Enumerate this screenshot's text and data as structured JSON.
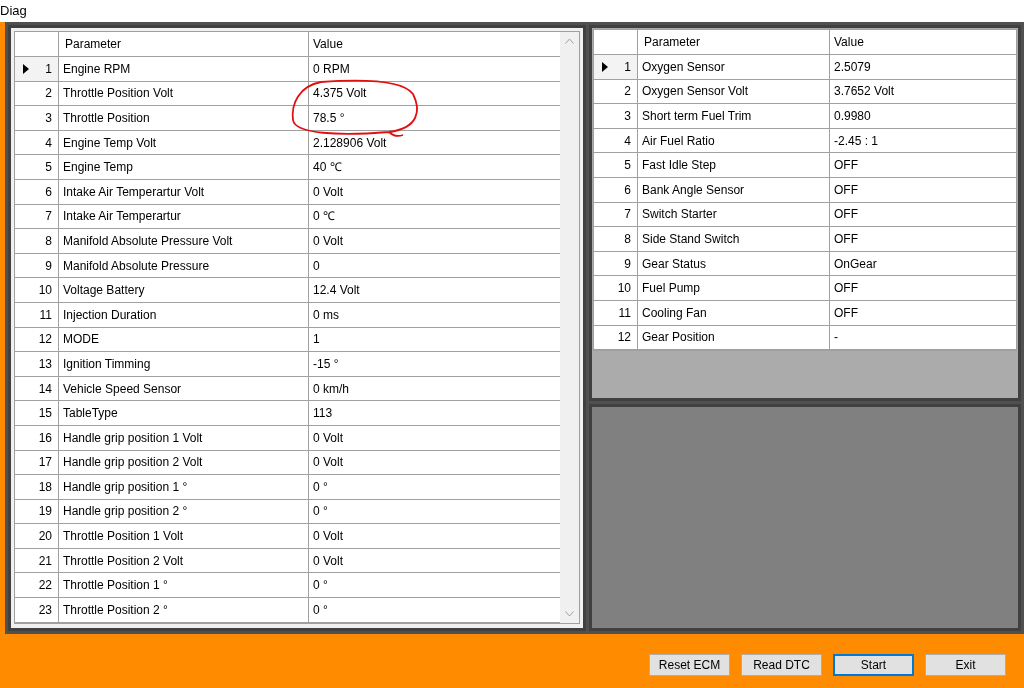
{
  "window": {
    "title": "Diag"
  },
  "left_table": {
    "columns": [
      "Parameter",
      "Value"
    ],
    "rows": [
      {
        "number": "1",
        "parameter": "Engine RPM",
        "value": "0 RPM",
        "selected": true
      },
      {
        "number": "2",
        "parameter": "Throttle Position Volt",
        "value": "4.375 Volt",
        "selected": false
      },
      {
        "number": "3",
        "parameter": "Throttle Position",
        "value": "78.5 °",
        "selected": false
      },
      {
        "number": "4",
        "parameter": "Engine Temp Volt",
        "value": "2.128906 Volt",
        "selected": false
      },
      {
        "number": "5",
        "parameter": "Engine Temp",
        "value": "40 ℃",
        "selected": false
      },
      {
        "number": "6",
        "parameter": "Intake Air Temperartur Volt",
        "value": "0 Volt",
        "selected": false
      },
      {
        "number": "7",
        "parameter": "Intake Air Temperartur",
        "value": "0 ℃",
        "selected": false
      },
      {
        "number": "8",
        "parameter": "Manifold Absolute Pressure Volt",
        "value": "0 Volt",
        "selected": false
      },
      {
        "number": "9",
        "parameter": "Manifold Absolute Pressure",
        "value": "0",
        "selected": false
      },
      {
        "number": "10",
        "parameter": "Voltage Battery",
        "value": "12.4 Volt",
        "selected": false
      },
      {
        "number": "11",
        "parameter": "Injection Duration",
        "value": "0 ms",
        "selected": false
      },
      {
        "number": "12",
        "parameter": "MODE",
        "value": "1",
        "selected": false
      },
      {
        "number": "13",
        "parameter": "Ignition Timming",
        "value": "-15 °",
        "selected": false
      },
      {
        "number": "14",
        "parameter": "Vehicle Speed Sensor",
        "value": "0 km/h",
        "selected": false
      },
      {
        "number": "15",
        "parameter": "TableType",
        "value": "113",
        "selected": false
      },
      {
        "number": "16",
        "parameter": "Handle grip position 1 Volt",
        "value": "0 Volt",
        "selected": false
      },
      {
        "number": "17",
        "parameter": "Handle grip position 2 Volt",
        "value": "0 Volt",
        "selected": false
      },
      {
        "number": "18",
        "parameter": "Handle grip position 1 °",
        "value": "0 °",
        "selected": false
      },
      {
        "number": "19",
        "parameter": "Handle grip position 2 °",
        "value": "0 °",
        "selected": false
      },
      {
        "number": "20",
        "parameter": "Throttle Position 1 Volt",
        "value": "0 Volt",
        "selected": false
      },
      {
        "number": "21",
        "parameter": "Throttle Position 2 Volt",
        "value": "0 Volt",
        "selected": false
      },
      {
        "number": "22",
        "parameter": "Throttle Position 1 °",
        "value": "0 °",
        "selected": false
      },
      {
        "number": "23",
        "parameter": "Throttle Position 2 °",
        "value": "0 °",
        "selected": false
      }
    ]
  },
  "right_table": {
    "columns": [
      "Parameter",
      "Value"
    ],
    "rows": [
      {
        "number": "1",
        "parameter": "Oxygen Sensor",
        "value": "2.5079",
        "selected": true
      },
      {
        "number": "2",
        "parameter": "Oxygen Sensor Volt",
        "value": "3.7652 Volt",
        "selected": false
      },
      {
        "number": "3",
        "parameter": "Short term Fuel Trim",
        "value": "0.9980",
        "selected": false
      },
      {
        "number": "4",
        "parameter": "Air Fuel Ratio",
        "value": "-2.45 : 1",
        "selected": false
      },
      {
        "number": "5",
        "parameter": "Fast Idle Step",
        "value": "OFF",
        "selected": false
      },
      {
        "number": "6",
        "parameter": "Bank Angle Sensor",
        "value": "OFF",
        "selected": false
      },
      {
        "number": "7",
        "parameter": "Switch Starter",
        "value": "OFF",
        "selected": false
      },
      {
        "number": "8",
        "parameter": "Side Stand Switch",
        "value": "OFF",
        "selected": false
      },
      {
        "number": "9",
        "parameter": "Gear Status",
        "value": "OnGear",
        "selected": false
      },
      {
        "number": "10",
        "parameter": "Fuel Pump",
        "value": "OFF",
        "selected": false
      },
      {
        "number": "11",
        "parameter": "Cooling Fan",
        "value": "OFF",
        "selected": false
      },
      {
        "number": "12",
        "parameter": "Gear Position",
        "value": "-",
        "selected": false
      }
    ]
  },
  "buttons": [
    {
      "label": "Reset ECM",
      "focused": false
    },
    {
      "label": "Read DTC",
      "focused": false
    },
    {
      "label": "Start",
      "focused": true
    },
    {
      "label": "Exit",
      "focused": false
    }
  ]
}
